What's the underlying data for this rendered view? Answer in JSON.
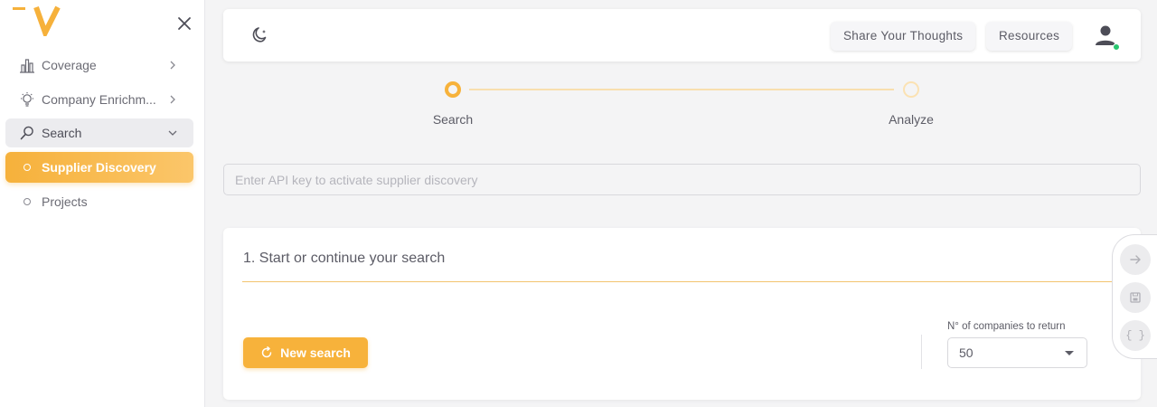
{
  "sidebar": {
    "logo_text": "V",
    "items": [
      {
        "label": "Coverage",
        "icon": "bar-chart-icon"
      },
      {
        "label": "Company Enrichm...",
        "icon": "lightbulb-icon"
      },
      {
        "label": "Search",
        "icon": "search-icon"
      }
    ],
    "sub_items": [
      {
        "label": "Supplier Discovery"
      },
      {
        "label": "Projects"
      }
    ]
  },
  "header": {
    "share_label": "Share Your Thoughts",
    "resources_label": "Resources"
  },
  "stepper": {
    "steps": [
      {
        "label": "Search",
        "state": "active"
      },
      {
        "label": "Analyze",
        "state": "inactive"
      }
    ]
  },
  "api": {
    "placeholder": "Enter API key to activate supplier discovery",
    "value": ""
  },
  "search_card": {
    "title": "1. Start or continue your search",
    "new_search_label": "New search",
    "count_label": "N° of companies to return",
    "count_value": "50"
  },
  "rail": {
    "json_glyph": "{ }"
  },
  "colors": {
    "accent": "#f7b23b",
    "online": "#28c76f"
  }
}
